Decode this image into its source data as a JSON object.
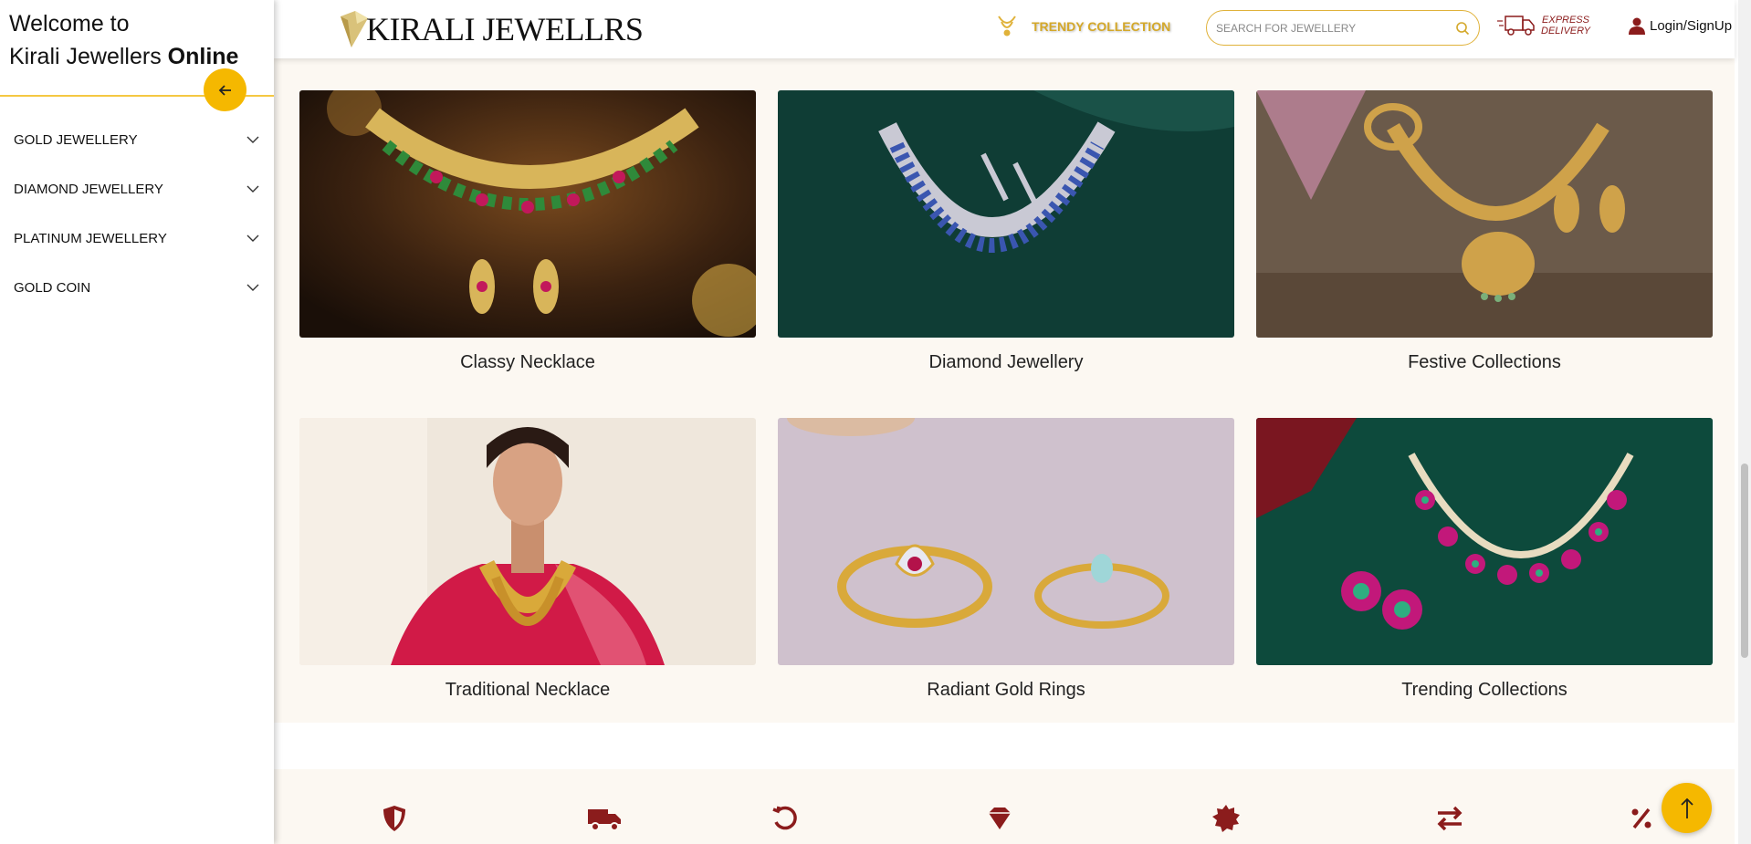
{
  "sidebar": {
    "welcome_line1": "Welcome to",
    "welcome_line2": "Kirali Jewellers",
    "welcome_bold": "Online",
    "back_icon": "arrow-left-icon",
    "items": [
      {
        "label": "GOLD JEWELLERY"
      },
      {
        "label": "DIAMOND JEWELLERY"
      },
      {
        "label": "PLATINUM JEWELLERY"
      },
      {
        "label": "GOLD COIN"
      }
    ]
  },
  "header": {
    "logo_text": "KIRALI JEWELLRS",
    "trendy_label": "TRENDY COLLECTION",
    "search_placeholder": "SEARCH FOR JEWELLERY",
    "express_line1": "EXPRESS",
    "express_line2": "DELIVERY",
    "login_label": "Login/SignUp"
  },
  "collections": [
    {
      "caption": "Classy Necklace"
    },
    {
      "caption": "Diamond Jewellery"
    },
    {
      "caption": "Festive Collections"
    },
    {
      "caption": "Traditional Necklace"
    },
    {
      "caption": "Radiant Gold Rings"
    },
    {
      "caption": "Trending Collections"
    }
  ],
  "features": [
    "shield-icon",
    "truck-icon",
    "return-icon",
    "diamond-icon",
    "badge-icon",
    "exchange-icon",
    "percent-icon"
  ],
  "colors": {
    "accent": "#f5b800",
    "brand_red": "#8b1c1c",
    "gold_text": "#d4a82a",
    "panel_bg": "#fcf8f2"
  }
}
